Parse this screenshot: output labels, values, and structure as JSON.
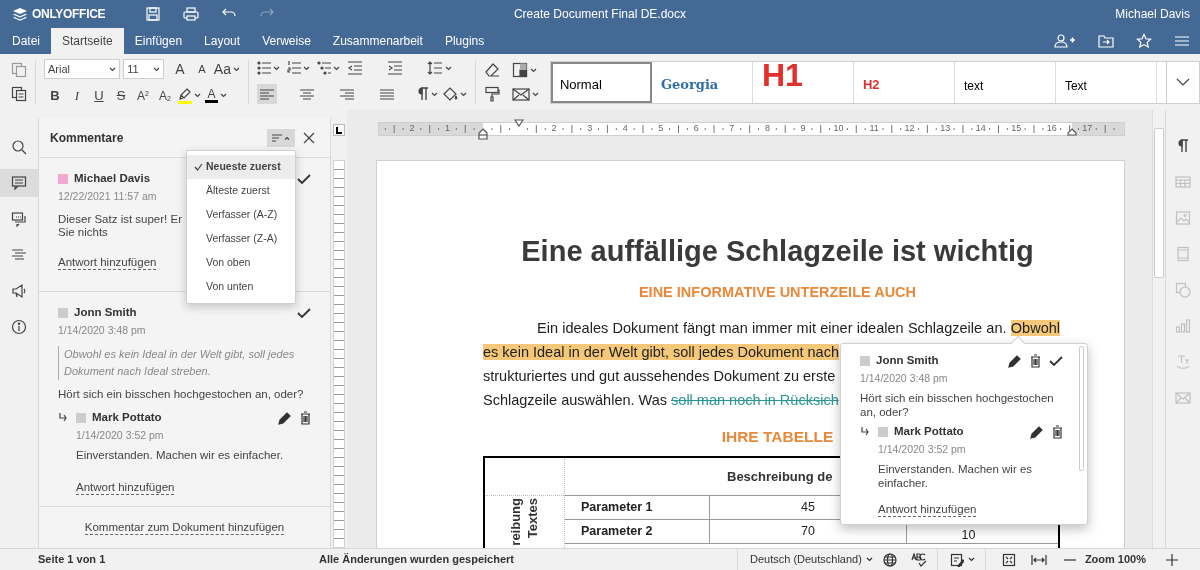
{
  "header": {
    "logo": "ONLYOFFICE",
    "title": "Create Document Final DE.docx",
    "user": "Michael Davis",
    "quick_actions": [
      {
        "kind": "save",
        "disabled": false
      },
      {
        "kind": "print",
        "disabled": false
      },
      {
        "kind": "undo",
        "disabled": false
      },
      {
        "kind": "redo",
        "disabled": true
      }
    ]
  },
  "tabs": [
    {
      "label": "Datei",
      "selected": false
    },
    {
      "label": "Startseite",
      "selected": true
    },
    {
      "label": "Einfügen",
      "selected": false
    },
    {
      "label": "Layout",
      "selected": false
    },
    {
      "label": "Verweise",
      "selected": false
    },
    {
      "label": "Zusammenarbeit",
      "selected": false
    },
    {
      "label": "Plugins",
      "selected": false
    }
  ],
  "tab_actions": [
    {
      "kind": "add_user"
    },
    {
      "kind": "open_location"
    },
    {
      "kind": "favorite"
    },
    {
      "kind": "menu"
    }
  ],
  "toolbar": {
    "font": "Arial",
    "font_size": "11",
    "font_buttons": [
      {
        "kind": "grow",
        "label": "A"
      },
      {
        "kind": "shrink",
        "label": "A"
      },
      {
        "kind": "case",
        "label": "Aa"
      }
    ],
    "format_buttons": [
      {
        "kind": "bold",
        "label": "B"
      },
      {
        "kind": "italic",
        "label": "I"
      },
      {
        "kind": "underline",
        "label": "U"
      },
      {
        "kind": "strike",
        "label": "S"
      },
      {
        "kind": "superscript",
        "label": "A$^{2}$"
      },
      {
        "kind": "subscript",
        "label": "A$_{2}$"
      },
      {
        "kind": "highlight"
      },
      {
        "kind": "font_color",
        "label": "A"
      }
    ],
    "alignments": [
      {
        "kind": "left",
        "selected": true
      },
      {
        "kind": "center",
        "selected": false
      },
      {
        "kind": "right",
        "selected": false
      },
      {
        "kind": "justify",
        "selected": false
      }
    ],
    "styles": [
      {
        "kind": "normal",
        "label": "Normal",
        "selected": true
      },
      {
        "kind": "georgia",
        "label": "Georgia",
        "selected": false
      },
      {
        "kind": "h1",
        "label": "H1",
        "selected": false
      },
      {
        "kind": "h2",
        "label": "H2",
        "selected": false
      },
      {
        "kind": "plain",
        "label": "text",
        "selected": false
      },
      {
        "kind": "plain",
        "label": "Text",
        "selected": false
      }
    ]
  },
  "left_rail": [
    {
      "kind": "search",
      "selected": false
    },
    {
      "kind": "comments",
      "selected": true
    },
    {
      "kind": "chat",
      "selected": false
    },
    {
      "kind": "navigation",
      "selected": false
    },
    {
      "kind": "feedback",
      "selected": false
    },
    {
      "kind": "about",
      "selected": false
    }
  ],
  "comments_panel": {
    "title": "Kommentare",
    "sort_menu": [
      {
        "label": "Neueste zuerst",
        "selected": true
      },
      {
        "label": "Älteste zuerst",
        "selected": false
      },
      {
        "label": "Verfasser (A-Z)",
        "selected": false
      },
      {
        "label": "Verfasser (Z-A)",
        "selected": false
      },
      {
        "label": "Von oben",
        "selected": false
      },
      {
        "label": "Von unten",
        "selected": false
      }
    ],
    "comments": [
      {
        "author": "Michael Davis",
        "color": "#f4a7cf",
        "date": "12/22/2021 11:57 am",
        "text_lines": [
          "Dieser Satz ist super! Er",
          "Sie nichts"
        ],
        "reply_link": "Antwort hinzufügen"
      },
      {
        "author": "Jonn Smith",
        "color": "#cccccc",
        "date": "1/14/2020 3:48 pm",
        "quote": "Obwohl es kein Ideal in der Welt gibt, soll jedes Dokument nach Ideal streben.",
        "text_lines": [
          "Hört sich ein bisschen hochgestochen an, oder?"
        ],
        "replies": [
          {
            "author": "Mark Pottato",
            "color": "#cccccc",
            "date": "1/14/2020 3:52 pm",
            "text": "Einverstanden. Machen wir es einfacher."
          }
        ],
        "reply_link": "Antwort hinzufügen"
      }
    ],
    "add_comment": "Kommentar zum Dokument hinzufügen"
  },
  "ruler": {
    "left_labels": [
      "2",
      "1"
    ],
    "right_labels": [
      "2",
      "3",
      "4",
      "5",
      "6",
      "7",
      "8",
      "9",
      "10",
      "11",
      "12",
      "13",
      "14",
      "15",
      "16",
      "17"
    ]
  },
  "document": {
    "title": "Eine auffällige Schlagzeile ist wichtig",
    "subtitle": "EINE INFORMATIVE UNTERZEILE AUCH",
    "paragraph_lines": [
      [
        {
          "kind": "plain",
          "text": "Ein ideales Dokument fängt man immer mit einer idealen Schlagzeile an. "
        },
        {
          "kind": "highlight",
          "text": "Obwohl"
        }
      ],
      [
        {
          "kind": "highlight",
          "text": "es kein Ideal in der Welt gibt, soll jedes Dokument nach"
        }
      ],
      [
        {
          "kind": "plain",
          "text": "strukturiertes und gut aussehendes Dokument zu erste"
        }
      ],
      [
        {
          "kind": "plain",
          "text": "Schlagzeile auswählen. Was "
        },
        {
          "kind": "deleted",
          "text": "soll man noch in Rücksich"
        }
      ]
    ],
    "table_title": "IHRE TABELLE",
    "table": {
      "header": "Beschreibung de",
      "side_label": [
        "reibung",
        "Textes"
      ],
      "rows": [
        {
          "label": "Parameter 1",
          "value": "45"
        },
        {
          "label": "Parameter 2",
          "value": "70",
          "column_4": "10"
        }
      ]
    }
  },
  "comment_popup": {
    "author": "Jonn Smith",
    "color": "#cccccc",
    "date": "1/14/2020 3:48 pm",
    "text": "Hört sich ein bisschen hochgestochen an, oder?",
    "replies": [
      {
        "author": "Mark Pottato",
        "color": "#cccccc",
        "date": "1/14/2020 3:52 pm",
        "text": "Einverstanden. Machen wir es einfacher."
      }
    ],
    "reply_link": "Antwort hinzufügen"
  },
  "right_sidebar": [
    {
      "kind": "paragraph",
      "disabled": false
    },
    {
      "kind": "table",
      "disabled": true
    },
    {
      "kind": "image",
      "disabled": true
    },
    {
      "kind": "header_footer",
      "disabled": true
    },
    {
      "kind": "shape",
      "disabled": true
    },
    {
      "kind": "chart",
      "disabled": true
    },
    {
      "kind": "text_art",
      "disabled": true
    },
    {
      "kind": "mail_merge",
      "disabled": true
    }
  ],
  "status_bar": {
    "page": "Seite 1 von 1",
    "saved": "Alle Änderungen wurden gespeichert",
    "language": "Deutsch (Deutschland)",
    "zoom": "Zoom 100%"
  }
}
